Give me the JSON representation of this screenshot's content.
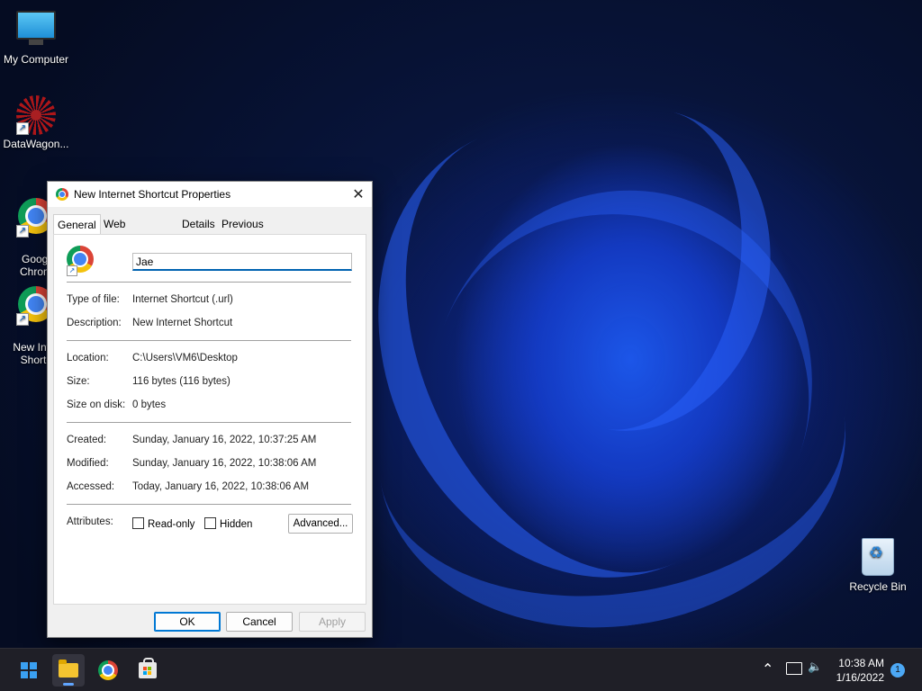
{
  "desktop": {
    "icons": [
      {
        "label": "My Computer"
      },
      {
        "label": "DataWagon..."
      },
      {
        "label": "Googl\nChrom"
      },
      {
        "label": "New Inter\nShortc"
      },
      {
        "label": "Recycle Bin"
      }
    ]
  },
  "dialog": {
    "title": "New Internet Shortcut Properties",
    "close_glyph": "✕",
    "tabs": [
      {
        "label": "General",
        "active": true
      },
      {
        "label": "Web Document"
      },
      {
        "label": "Details"
      },
      {
        "label": "Previous Versions"
      }
    ],
    "name_value": "Jae",
    "rows": {
      "type_label": "Type of file:",
      "type_value": "Internet Shortcut (.url)",
      "desc_label": "Description:",
      "desc_value": "New Internet Shortcut",
      "location_label": "Location:",
      "location_value": "C:\\Users\\VM6\\Desktop",
      "size_label": "Size:",
      "size_value": "116 bytes (116 bytes)",
      "disk_label": "Size on disk:",
      "disk_value": "0 bytes",
      "created_label": "Created:",
      "created_value": "Sunday, January 16, 2022, 10:37:25 AM",
      "modified_label": "Modified:",
      "modified_value": "Sunday, January 16, 2022, 10:38:06 AM",
      "accessed_label": "Accessed:",
      "accessed_value": "Today, January 16, 2022, 10:38:06 AM",
      "attributes_label": "Attributes:"
    },
    "readonly_label": "Read-only",
    "hidden_label": "Hidden",
    "advanced_label": "Advanced...",
    "ok_label": "OK",
    "cancel_label": "Cancel",
    "apply_label": "Apply"
  },
  "taskbar": {
    "time": "10:38 AM",
    "date": "1/16/2022",
    "notification_count": "1",
    "tray_up_glyph": "⌃",
    "volume_glyph": "🔈"
  },
  "colors": {
    "accent": "#0078d4",
    "taskbar": "#1f1f27"
  }
}
